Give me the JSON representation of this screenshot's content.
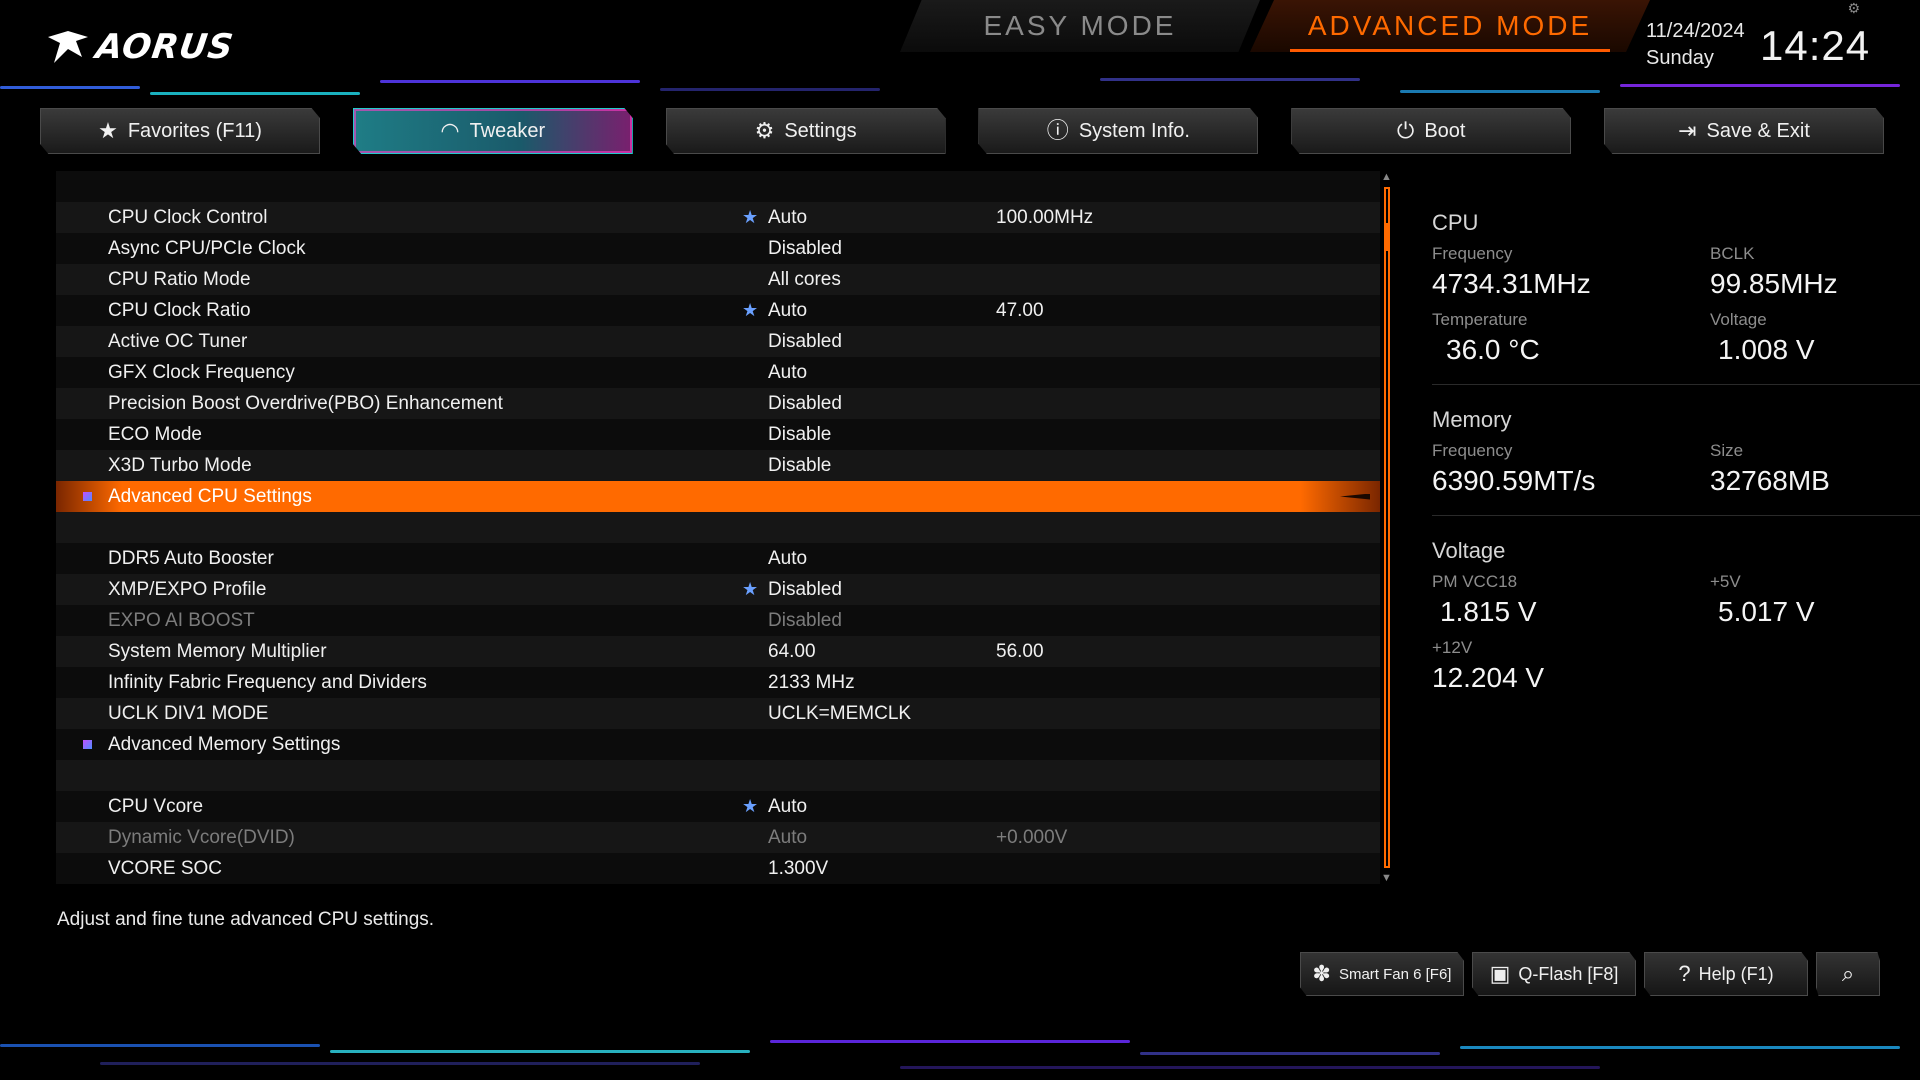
{
  "brand": {
    "name": "AORUS"
  },
  "modes": {
    "easy": "EASY MODE",
    "advanced": "ADVANCED MODE"
  },
  "datetime": {
    "date": "11/24/2024",
    "day": "Sunday",
    "time": "14:24"
  },
  "tabs": [
    {
      "label": "Favorites (F11)",
      "icon": "star-icon",
      "active": false
    },
    {
      "label": "Tweaker",
      "icon": "speedometer-icon",
      "active": true
    },
    {
      "label": "Settings",
      "icon": "gear-icon",
      "active": false
    },
    {
      "label": "System Info.",
      "icon": "info-icon",
      "active": false
    },
    {
      "label": "Boot",
      "icon": "power-icon",
      "active": false
    },
    {
      "label": "Save & Exit",
      "icon": "exit-icon",
      "active": false
    }
  ],
  "settings": [
    {
      "label": "",
      "value": "",
      "value2": ""
    },
    {
      "label": "CPU Clock Control",
      "value": "Auto",
      "value2": "100.00MHz",
      "star": true
    },
    {
      "label": "Async CPU/PCIe Clock",
      "value": "Disabled",
      "value2": ""
    },
    {
      "label": "CPU Ratio Mode",
      "value": "All cores",
      "value2": ""
    },
    {
      "label": "CPU Clock Ratio",
      "value": "Auto",
      "value2": "47.00",
      "star": true
    },
    {
      "label": "Active OC Tuner",
      "value": "Disabled",
      "value2": ""
    },
    {
      "label": "GFX Clock Frequency",
      "value": "Auto",
      "value2": ""
    },
    {
      "label": "Precision Boost Overdrive(PBO) Enhancement",
      "value": "Disabled",
      "value2": ""
    },
    {
      "label": "ECO Mode",
      "value": "Disable",
      "value2": ""
    },
    {
      "label": "X3D Turbo Mode",
      "value": "Disable",
      "value2": ""
    },
    {
      "label": "Advanced CPU Settings",
      "value": "",
      "value2": "",
      "submenu": true,
      "selected": true
    },
    {
      "label": "",
      "value": "",
      "value2": ""
    },
    {
      "label": "DDR5 Auto Booster",
      "value": "Auto",
      "value2": ""
    },
    {
      "label": "XMP/EXPO Profile",
      "value": "Disabled",
      "value2": "",
      "star": true
    },
    {
      "label": "EXPO AI BOOST",
      "value": "Disabled",
      "value2": "",
      "disabled": true
    },
    {
      "label": "System Memory Multiplier",
      "value": "64.00",
      "value2": "56.00"
    },
    {
      "label": "Infinity Fabric Frequency and Dividers",
      "value": "2133 MHz",
      "value2": ""
    },
    {
      "label": "UCLK DIV1 MODE",
      "value": "UCLK=MEMCLK",
      "value2": ""
    },
    {
      "label": "Advanced Memory Settings",
      "value": "",
      "value2": "",
      "submenu": true
    },
    {
      "label": "",
      "value": "",
      "value2": ""
    },
    {
      "label": "CPU Vcore",
      "value": "Auto",
      "value2": "",
      "star": true
    },
    {
      "label": "Dynamic Vcore(DVID)",
      "value": "Auto",
      "value2": "+0.000V",
      "disabled": true
    },
    {
      "label": "VCORE SOC",
      "value": "1.300V",
      "value2": ""
    }
  ],
  "scroll": {
    "position_fraction": 0.05
  },
  "help_text": "Adjust and fine tune advanced CPU settings.",
  "info": {
    "cpu": {
      "title": "CPU",
      "frequency_label": "Frequency",
      "frequency": "4734.31MHz",
      "bclk_label": "BCLK",
      "bclk": "99.85MHz",
      "temperature_label": "Temperature",
      "temperature": "36.0 °C",
      "voltage_label": "Voltage",
      "voltage": "1.008 V"
    },
    "memory": {
      "title": "Memory",
      "frequency_label": "Frequency",
      "frequency": "6390.59MT/s",
      "size_label": "Size",
      "size": "32768MB"
    },
    "voltage": {
      "title": "Voltage",
      "pmvcc18_label": "PM VCC18",
      "pmvcc18": "1.815 V",
      "p5v_label": "+5V",
      "p5v": "5.017 V",
      "p12v_label": "+12V",
      "p12v": "12.204 V"
    }
  },
  "bottom_buttons": [
    {
      "label": "Smart Fan 6 [F6]",
      "icon": "fan-icon"
    },
    {
      "label": "Q-Flash [F8]",
      "icon": "chip-icon"
    },
    {
      "label": "Help (F1)",
      "icon": "help-icon"
    },
    {
      "label": "",
      "icon": "search-icon"
    }
  ],
  "colors": {
    "accent": "#ff6a00",
    "tab_active": "#1f7d86",
    "bullet": "#8a5cff",
    "star": "#6aa0ff"
  }
}
